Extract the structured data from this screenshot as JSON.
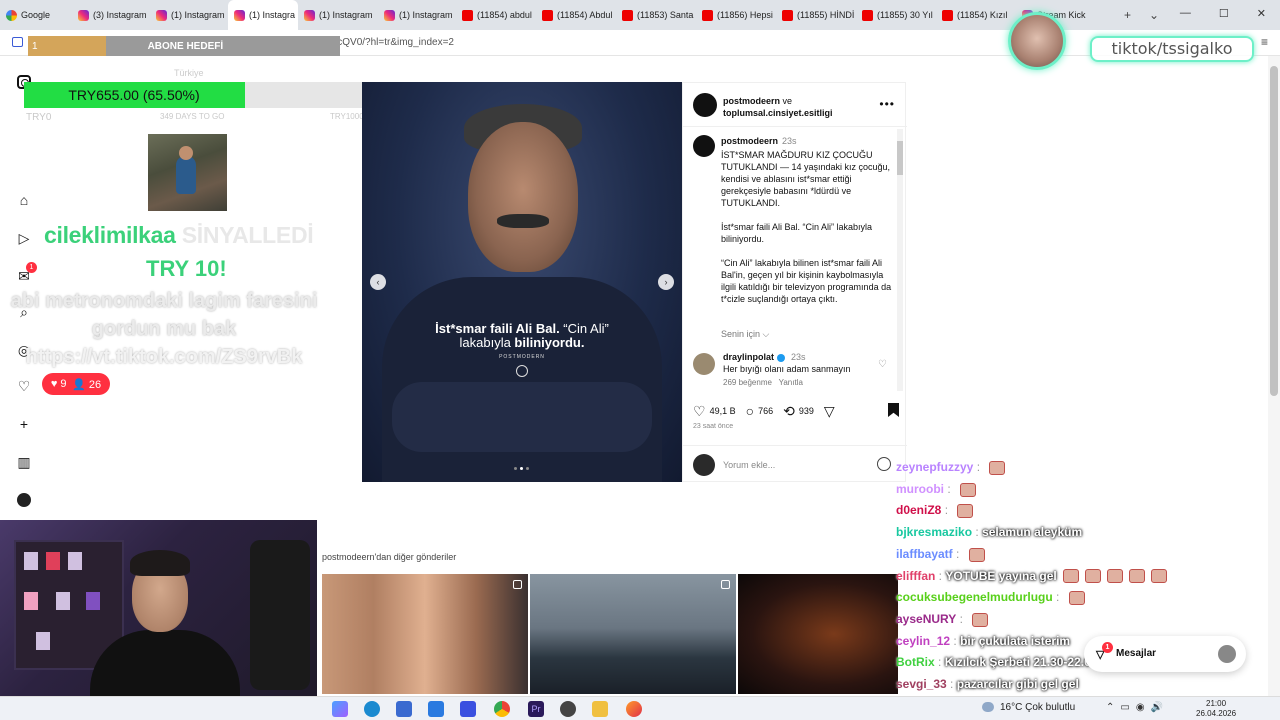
{
  "browser": {
    "tabs": [
      {
        "label": "Google",
        "icon": "g"
      },
      {
        "label": "(3) Instagram",
        "icon": "ig"
      },
      {
        "label": "(1) Instagram",
        "icon": "ig"
      },
      {
        "label": "(1) Instagra",
        "icon": "ig",
        "active": true
      },
      {
        "label": "(1) Instagram",
        "icon": "ig"
      },
      {
        "label": "(1) Instagram",
        "icon": "ig"
      },
      {
        "label": "(11854) abdul",
        "icon": "yt"
      },
      {
        "label": "(11854) Abdul",
        "icon": "yt"
      },
      {
        "label": "(11853) Santa",
        "icon": "yt"
      },
      {
        "label": "(11856) Hepsi",
        "icon": "yt"
      },
      {
        "label": "(11855) HİNDİ",
        "icon": "yt"
      },
      {
        "label": "(11855) 30 Yıl",
        "icon": "yt"
      },
      {
        "label": "(11854) Kızıl",
        "icon": "yt"
      },
      {
        "label": "Stream Kick",
        "icon": "ig"
      }
    ],
    "new_tab": "+",
    "tab_list": "⌄",
    "url": "instagram.com/p/DXkJIXvicQV0/?hl=tr&img_index=2",
    "win_controls": [
      "—",
      "☐",
      "✕"
    ]
  },
  "overlay": {
    "abone_value": "1",
    "abone_label": "ABONE HEDEFİ",
    "abone_progress": 0.25,
    "donation_title": "Türkiye",
    "donation_amount": "TRY655.00 (65.50%)",
    "donation_progress": 0.655,
    "donation_low": "TRY0",
    "donation_mid": "349 DAYS TO GO",
    "donation_high": "TRY1000",
    "alert_user": "cileklimilkaa",
    "alert_rest": " SİNYALLEDİ",
    "alert_amount": "TRY 10!",
    "alert_line1": "abi metronomdaki lagim faresini",
    "alert_line2": "gordun mu bak",
    "alert_line3": "https://vt.tiktok.com/ZS9rvBk",
    "likes": "9",
    "followers": "26",
    "tiktok_handle": "tiktok/tssigalko"
  },
  "post": {
    "overlay_caption_a": "İst*smar faili Ali Bal.",
    "overlay_caption_b": " “Cin Ali” lakabıyla ",
    "overlay_caption_c": "biliniyordu.",
    "overlay_brand": "POSTMODERN",
    "author": "postmodeern",
    "and": " ve",
    "collaborator": "toplumsal.cinsiyet.esitligi",
    "caption_time": "23s",
    "caption_p1": "İST*SMAR MAĞDURU KIZ ÇOCUĞU TUTUKLANDI — 14 yaşındaki kız çocuğu, kendisi ve ablasını ist*smar ettiği gerekçesiyle babasını *ldürdü ve TUTUKLANDI.",
    "caption_p2": "İst*smar faili Ali Bal. “Cin Ali” lakabıyla biliniyordu.",
    "caption_p3": "“Cin Ali” lakabıyla bilinen ist*smar faili Ali Bal'in, geçen yıl bir kişinin kaybolmasıyla ilgili katıldığı bir televizyon programında da t*cizle suçlandığı ortaya çıktı.",
    "translate": "Senin için ⌵",
    "comment_user": "draylinpolat",
    "comment_time": "23s",
    "comment_text": "Her bıyığı olanı adam sanmayın",
    "comment_likes": "269 beğenme",
    "comment_reply": "Yanıtla",
    "like_count": "49,1 B",
    "comment_count": "766",
    "share_count": "939",
    "posted": "23 saat önce",
    "comment_placeholder": "Yorum ekle...",
    "more_from": "postmodeern'dan diğer gönderiler"
  },
  "chat": [
    {
      "user": "zeynepfuzzyy",
      "color": "#b983ff",
      "text": "",
      "emotes": 1
    },
    {
      "user": "muroobi",
      "color": "#d090ff",
      "text": "",
      "emotes": 1
    },
    {
      "user": "d0eniZ8",
      "color": "#d0104a",
      "text": "",
      "emotes": 1
    },
    {
      "user": "bjkresmaziko",
      "color": "#18c8a0",
      "text": "selamun aleyküm",
      "emotes": 0
    },
    {
      "user": "ilaffbayatf",
      "color": "#6a8cff",
      "text": "",
      "emotes": 1
    },
    {
      "user": "elifffan",
      "color": "#e0406a",
      "text": "YOTUBE yayına gel",
      "emotes": 5
    },
    {
      "user": "cocuksubegenelmudurlugu",
      "color": "#58d01a",
      "text": "",
      "emotes": 1
    },
    {
      "user": "ayseNURY",
      "color": "#9a2a8a",
      "text": "",
      "emotes": 1
    },
    {
      "user": "ceylin_12",
      "color": "#c040c0",
      "text": "bir çukulata isterim",
      "emotes": 0
    },
    {
      "user": "BotRix",
      "color": "#40d040",
      "text": "Kızılcık Şerbeti 21.30-22.00 Gibi",
      "emotes": 0
    },
    {
      "user": "sevgi_33",
      "color": "#a04060",
      "text": "pazarcılar gibi gel gel",
      "emotes": 0
    }
  ],
  "messages_label": "Mesajlar",
  "messages_badge": "1",
  "taskbar": {
    "weather": "16°C  Çok bulutlu",
    "time": "21:00",
    "date": "26.04.2026"
  }
}
